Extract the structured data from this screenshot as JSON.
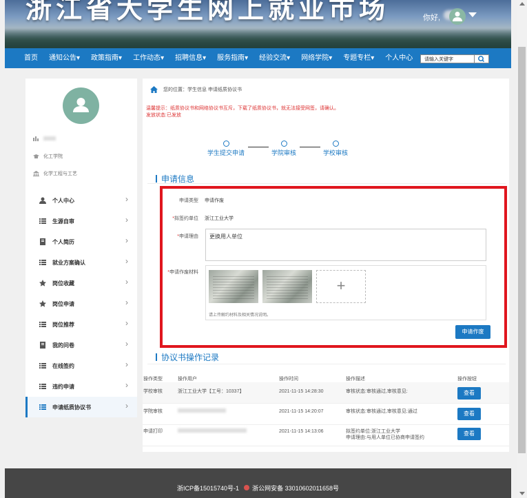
{
  "header": {
    "title": "浙江省大学生网上就业市场",
    "greeting": "你好,"
  },
  "nav": {
    "items": [
      "首页",
      "通知公告",
      "政策指南",
      "工作动态",
      "招聘信息",
      "服务指南",
      "经验交流",
      "网络学院",
      "专题专栏",
      "个人中心"
    ],
    "search_placeholder": "请输入关键字"
  },
  "profile": {
    "college": "化工学院",
    "major": "化学工程与工艺"
  },
  "sidebar": {
    "items": [
      {
        "label": "个人中心",
        "icon": "user-icon"
      },
      {
        "label": "生源自审",
        "icon": "list-icon"
      },
      {
        "label": "个人简历",
        "icon": "document-icon"
      },
      {
        "label": "就业方案确认",
        "icon": "list-icon"
      },
      {
        "label": "岗位收藏",
        "icon": "star-icon"
      },
      {
        "label": "岗位申请",
        "icon": "star-icon"
      },
      {
        "label": "岗位推荐",
        "icon": "list-icon"
      },
      {
        "label": "我的问卷",
        "icon": "document-icon"
      },
      {
        "label": "在线签约",
        "icon": "list-icon"
      },
      {
        "label": "违约申请",
        "icon": "list-icon"
      },
      {
        "label": "申请纸质协议书",
        "icon": "list-icon"
      }
    ],
    "active": "申请纸质协议书"
  },
  "breadcrumb": {
    "text": "您的位置：学生信息  申请纸质协议书"
  },
  "tip": {
    "line1": "温馨提示：纸质协议书和网络协议书互斥，下载了纸质协议书，就无法接受网签，请确认。",
    "line2": "发放状态:已发放"
  },
  "steps": [
    "学生提交申请",
    "学院审核",
    "学校审核"
  ],
  "application": {
    "section_title": "申请信息",
    "type_label": "申请类型",
    "type_value": "申请作废",
    "unit_label": "拟签约单位",
    "unit_value": "浙江工业大学",
    "reason_label": "申请理由",
    "reason_value": "更换用人单位",
    "material_label": "申请作废材料",
    "upload_hint": "请上传解约材料及相关情况说明。",
    "submit_label": "申请作废"
  },
  "records": {
    "section_title": "协议书操作记录",
    "headers": [
      "操作类型",
      "操作用户",
      "操作时间",
      "操作描述",
      "操作按钮"
    ],
    "rows": [
      {
        "type": "学校审核",
        "user": "浙江工业大学【工号：10337】",
        "time": "2021-11-15 14:28:30",
        "desc1": "审核状态:审核通过,审核意见:",
        "desc2": "",
        "action": "查看"
      },
      {
        "type": "学院审核",
        "user": "",
        "time": "2021-11-15 14:20:07",
        "desc1": "审核状态:审核通过,审核意见:通过",
        "desc2": "",
        "action": "查看"
      },
      {
        "type": "申请打印",
        "user": "",
        "time": "2021-11-15 14:13:06",
        "desc1": "拟签约单位:浙江工业大学",
        "desc2": "申请理由:与用人单位已协商申请签约",
        "action": "查看"
      }
    ]
  },
  "footer": {
    "icp": "浙ICP备15015740号-1",
    "police": "浙公网安备 33010602011658号"
  }
}
